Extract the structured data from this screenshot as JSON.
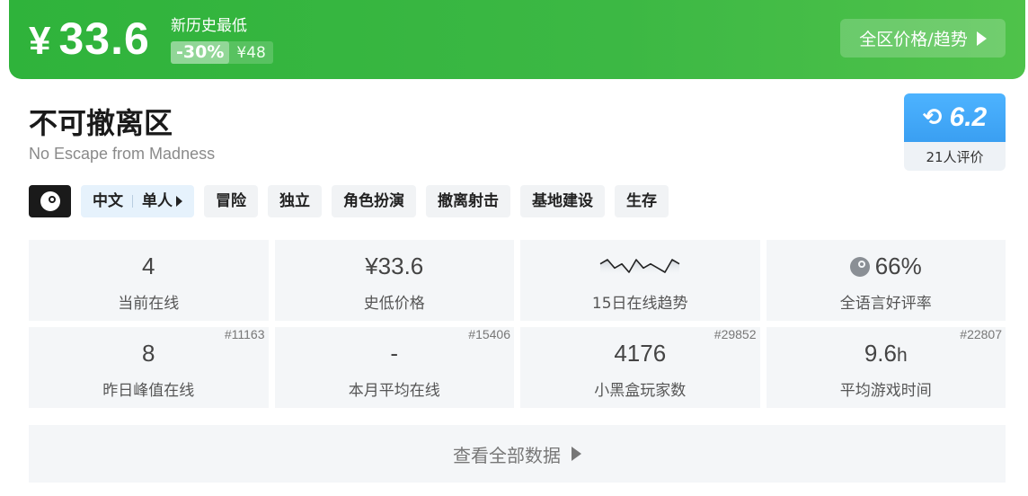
{
  "banner": {
    "currency": "¥",
    "price": "33.6",
    "low_label": "新历史最低",
    "discount": "-30%",
    "original": "¥48",
    "region_button": "全区价格/趋势",
    "color": "#3cb844"
  },
  "game": {
    "title": "不可撤离区",
    "subtitle": "No Escape from Madness"
  },
  "score": {
    "value": "6.2",
    "reviews": "21人评价"
  },
  "tags": {
    "lang": "中文",
    "mode": "单人",
    "items": [
      "冒险",
      "独立",
      "角色扮演",
      "撤离射击",
      "基地建设",
      "生存"
    ]
  },
  "stats": [
    {
      "value": "4",
      "label": "当前在线",
      "rank": ""
    },
    {
      "value": "¥33.6",
      "label": "史低价格",
      "rank": ""
    },
    {
      "value": "",
      "label": "15日在线趋势",
      "rank": "",
      "trend": [
        3,
        4,
        2,
        3,
        1,
        4,
        2,
        3,
        2,
        1,
        4,
        3
      ]
    },
    {
      "value": "66%",
      "label": "全语言好评率",
      "rank": ""
    },
    {
      "value": "8",
      "label": "昨日峰值在线",
      "rank": "#11163"
    },
    {
      "value": "-",
      "label": "本月平均在线",
      "rank": "#15406"
    },
    {
      "value": "4176",
      "label": "小黑盒玩家数",
      "rank": "#29852"
    },
    {
      "value": "9.6",
      "unit": "h",
      "label": "平均游戏时间",
      "rank": "#22807"
    }
  ],
  "more_button": "查看全部数据"
}
